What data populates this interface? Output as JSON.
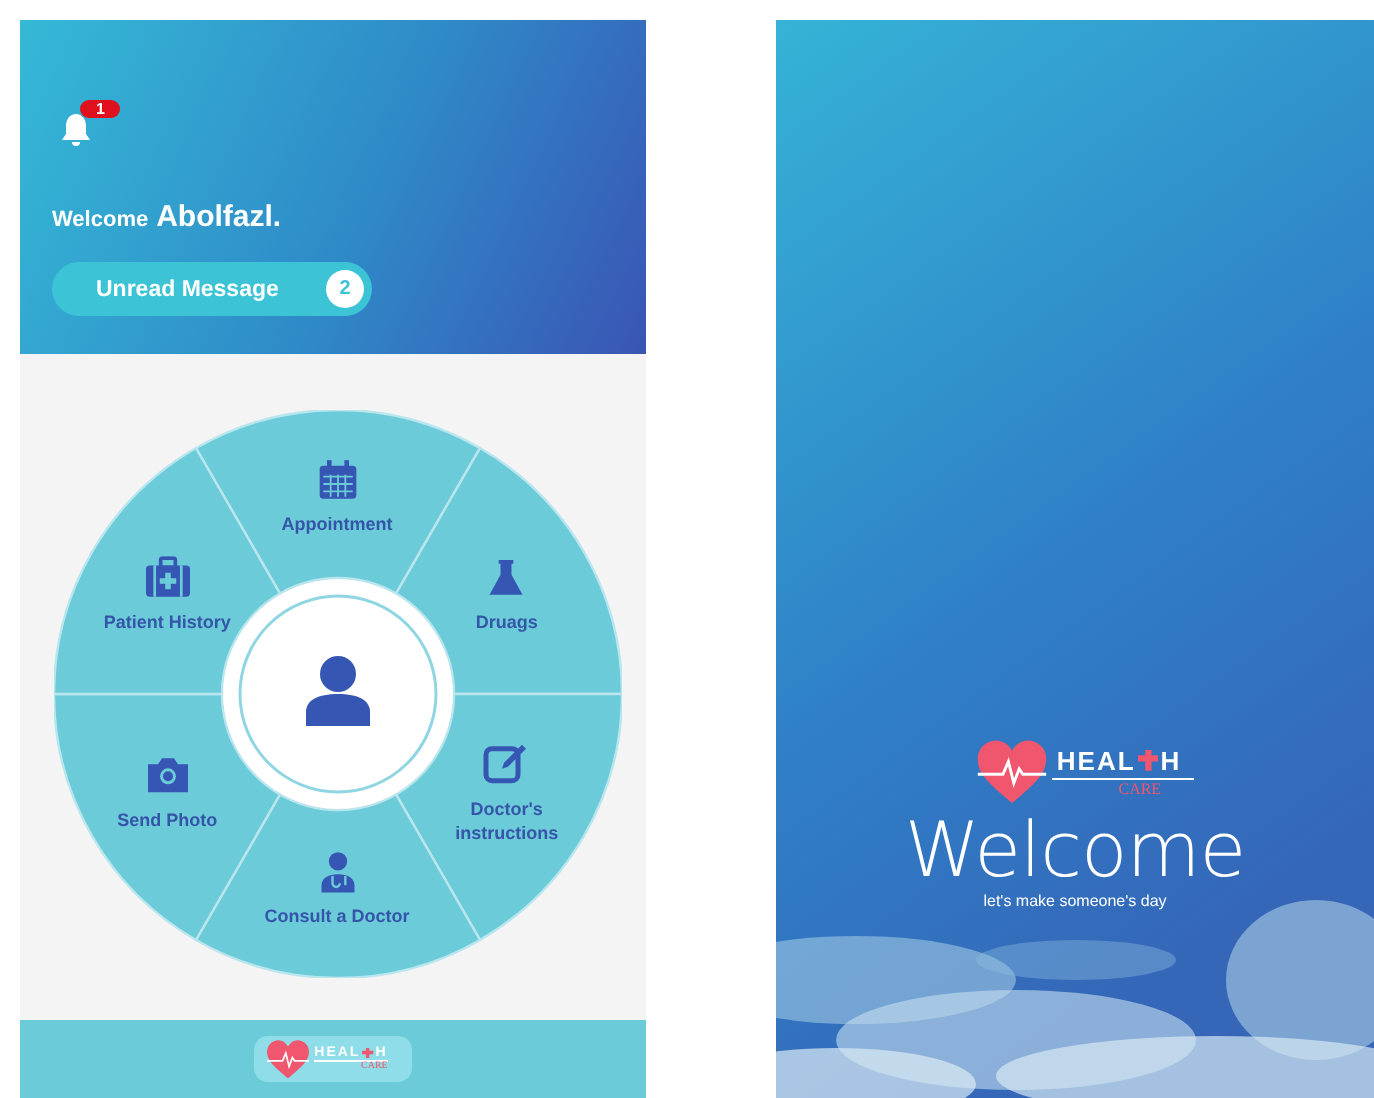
{
  "notifications": {
    "count": "1"
  },
  "greeting": {
    "label": "Welcome",
    "name": "Abolfazl."
  },
  "unread": {
    "label": "Unread Message",
    "count": "2"
  },
  "menu": {
    "items": [
      {
        "label": "Appointment",
        "kind": "calendar"
      },
      {
        "label": "Druags",
        "kind": "flask"
      },
      {
        "label": "Doctor's instructions",
        "kind": "edit"
      },
      {
        "label": "Consult a Doctor",
        "kind": "doctor"
      },
      {
        "label": "Send Photo",
        "kind": "camera"
      },
      {
        "label": "Patient History",
        "kind": "medkit"
      }
    ]
  },
  "footer_logo": {
    "word_start": "HEAL",
    "word_end": "H",
    "subtitle": "CARE"
  },
  "splash": {
    "logo": {
      "word_start": "HEAL",
      "word_end": "H",
      "subtitle": "CARE"
    },
    "title": "Welcome",
    "tagline": "let's make someone's day"
  }
}
